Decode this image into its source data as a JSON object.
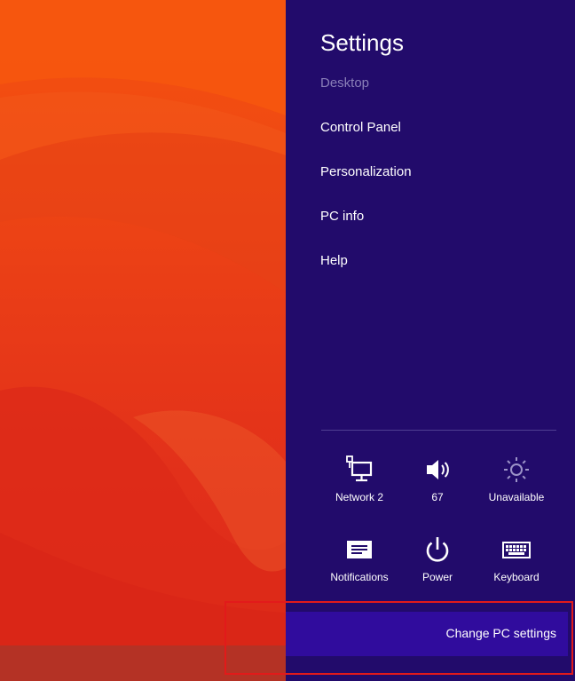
{
  "settings_pane": {
    "title": "Settings",
    "items": [
      {
        "label": "Desktop",
        "enabled": false
      },
      {
        "label": "Control Panel",
        "enabled": true
      },
      {
        "label": "Personalization",
        "enabled": true
      },
      {
        "label": "PC info",
        "enabled": true
      },
      {
        "label": "Help",
        "enabled": true
      }
    ]
  },
  "quick_settings": [
    {
      "label": "Network  2",
      "icon": "network-icon"
    },
    {
      "label": "67",
      "icon": "volume-icon"
    },
    {
      "label": "Unavailable",
      "icon": "brightness-icon"
    },
    {
      "label": "Notifications",
      "icon": "notifications-icon"
    },
    {
      "label": "Power",
      "icon": "power-icon"
    },
    {
      "label": "Keyboard",
      "icon": "keyboard-icon"
    }
  ],
  "change_pc_settings": {
    "label": "Change PC settings"
  },
  "colors": {
    "pane_background": "#220b6b",
    "accent": "#300c9d",
    "disabled_text": "#8a7fb8",
    "highlight_border": "#e21a1a"
  }
}
